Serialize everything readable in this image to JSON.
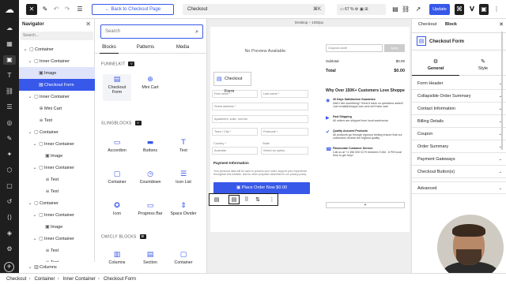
{
  "topbar": {
    "back_label": "← Back to Checkout Page",
    "document_title": "Checkout",
    "shortcut": "⌘K",
    "zoom": "67 %",
    "update_label": "Update"
  },
  "navigator": {
    "title": "Navigator",
    "search_placeholder": "Search...",
    "items": [
      {
        "label": "Container"
      },
      {
        "label": "Inner Container"
      },
      {
        "label": "Image"
      },
      {
        "label": "Checkout Form"
      },
      {
        "label": "Inner Container"
      },
      {
        "label": "Mini Cart"
      },
      {
        "label": "Text"
      },
      {
        "label": "Container"
      },
      {
        "label": "Inner Container"
      },
      {
        "label": "Image"
      },
      {
        "label": "Inner Container"
      },
      {
        "label": "Text"
      },
      {
        "label": "Text"
      },
      {
        "label": "Container"
      },
      {
        "label": "Inner Container"
      },
      {
        "label": "Image"
      },
      {
        "label": "Inner Container"
      },
      {
        "label": "Text"
      },
      {
        "label": "Text"
      },
      {
        "label": "Columns"
      }
    ]
  },
  "inserter": {
    "search_placeholder": "Search",
    "tabs": [
      "Blocks",
      "Patterns",
      "Media"
    ],
    "categories": [
      {
        "label": "FUNNELKIT",
        "blocks": [
          "Checkout Form",
          "Mini Cart"
        ]
      },
      {
        "label": "SLINGBLOCKS",
        "blocks": [
          "Accordion",
          "Buttons",
          "Text",
          "Container",
          "Countdown",
          "Icon List",
          "Icon",
          "Progress Bar",
          "Space Divider"
        ]
      },
      {
        "label": "CWICLY BLOCKS",
        "blocks": [
          "Columns",
          "Section",
          "Container"
        ]
      }
    ]
  },
  "canvas": {
    "device_label": "Desktop – 1092px",
    "no_preview": "No Preview Available.",
    "checkout_form_label": "Checkout Form",
    "coupon_placeholder": "Coupon code",
    "apply_label": "Apply",
    "subtotal_label": "Subtotal",
    "subtotal_value": "$0.00",
    "total_label": "Total",
    "total_value": "$0.00",
    "love_heading": "Why Over 150K+ Customers Love Shoppe",
    "features": [
      {
        "title": "30 Days Satisfaction Guarantee",
        "desc": "Didn't like something? Send it back no questions asked! Just email@shoppe.com and we'll take care"
      },
      {
        "title": "Fast Shipping",
        "desc": "All orders are shipped from local warehouse"
      },
      {
        "title": "Quality Assured Products",
        "desc": "All products go through rigorous testing ensure that our customers receive the highest quality"
      },
      {
        "title": "Passionate Customer Service",
        "desc": "Call us at +1 456 000 0179 between 9 AM - 6 PM local time to get help!"
      }
    ],
    "fields": [
      "First name *",
      "Last name *",
      "Street address *",
      "Apartment, suite, unit etc.",
      "Town / City *",
      "Postcode *",
      "Country *",
      "State",
      "Australia",
      "Select an option..."
    ],
    "payment_title": "Payment Information",
    "payment_desc": "Your personal data will be used to process your order, support your experience throughout this website, and for other purposes described in our privacy policy.",
    "place_order_label": "Place Order Now  $0.00",
    "minus_label": "+"
  },
  "inspector": {
    "tabs": [
      "Checkout",
      "Block"
    ],
    "block_name": "Checkout Form",
    "subtabs": [
      "General",
      "Style"
    ],
    "panels": [
      "Form Header",
      "Collapsible Order Summary",
      "Contact Information",
      "Billing Details",
      "Coupon",
      "Order Summary",
      "Payment Gateways",
      "Checkout Button(s)",
      "Advanced"
    ]
  },
  "breadcrumb": [
    "Checkout",
    "Container",
    "Inner Container",
    "Checkout Form"
  ],
  "colors": {
    "accent": "#3858e9",
    "dark": "#1e1e1e"
  }
}
